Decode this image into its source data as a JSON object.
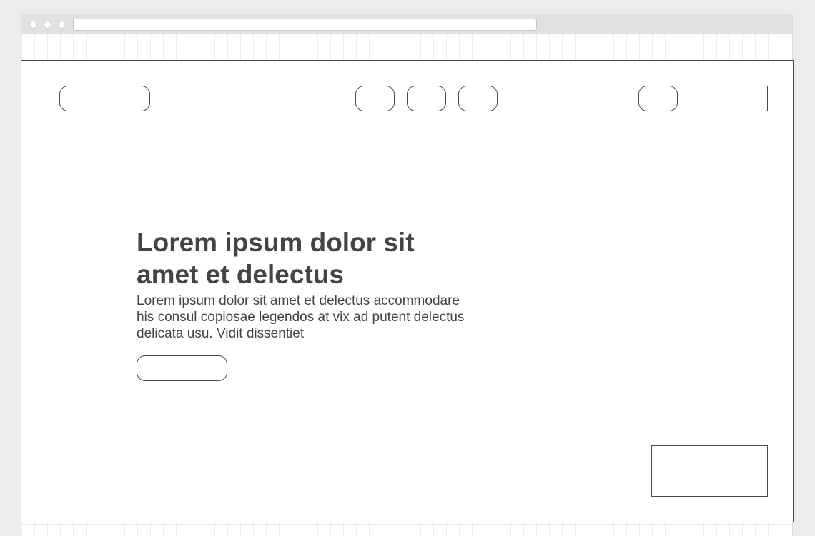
{
  "browser": {
    "url": ""
  },
  "hero": {
    "title": "Lorem ipsum dolor sit amet et delectus",
    "body": "Lorem ipsum dolor sit amet et delectus accommodare his consul copiosae legendos at vix ad putent delectus delicata usu. Vidit dissentiet"
  },
  "colors": {
    "text": "#444444",
    "outline": "#4a4a4a",
    "grid": "#ececec",
    "chrome": "#e1e1e1"
  }
}
